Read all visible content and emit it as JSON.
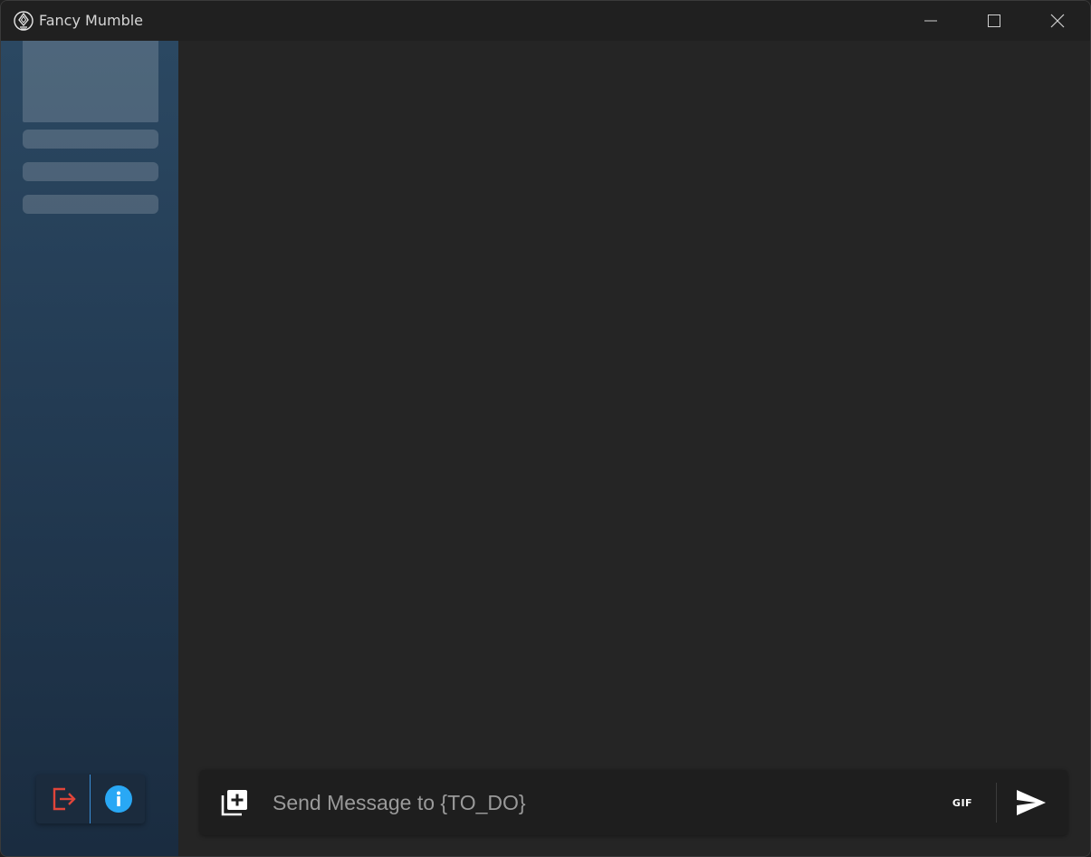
{
  "window": {
    "title": "Fancy Mumble",
    "controls": {
      "minimize_icon": "minimize-icon",
      "maximize_icon": "maximize-icon",
      "close_icon": "close-icon"
    }
  },
  "sidebar": {
    "actions": {
      "logout_icon": "logout-icon",
      "logout_color": "#e0453a",
      "info_icon": "info-icon",
      "info_color": "#29a8f5"
    }
  },
  "composer": {
    "attach_icon": "add-media-icon",
    "placeholder": "Send Message to {TO_DO}",
    "value": "",
    "gif_label": "GIF",
    "send_icon": "send-icon"
  },
  "colors": {
    "titlebar": "#202020",
    "main_background": "#252525",
    "sidebar_top": "#2b4862",
    "sidebar_bottom": "#1a2c40",
    "composer_background": "#1e1e1e"
  }
}
